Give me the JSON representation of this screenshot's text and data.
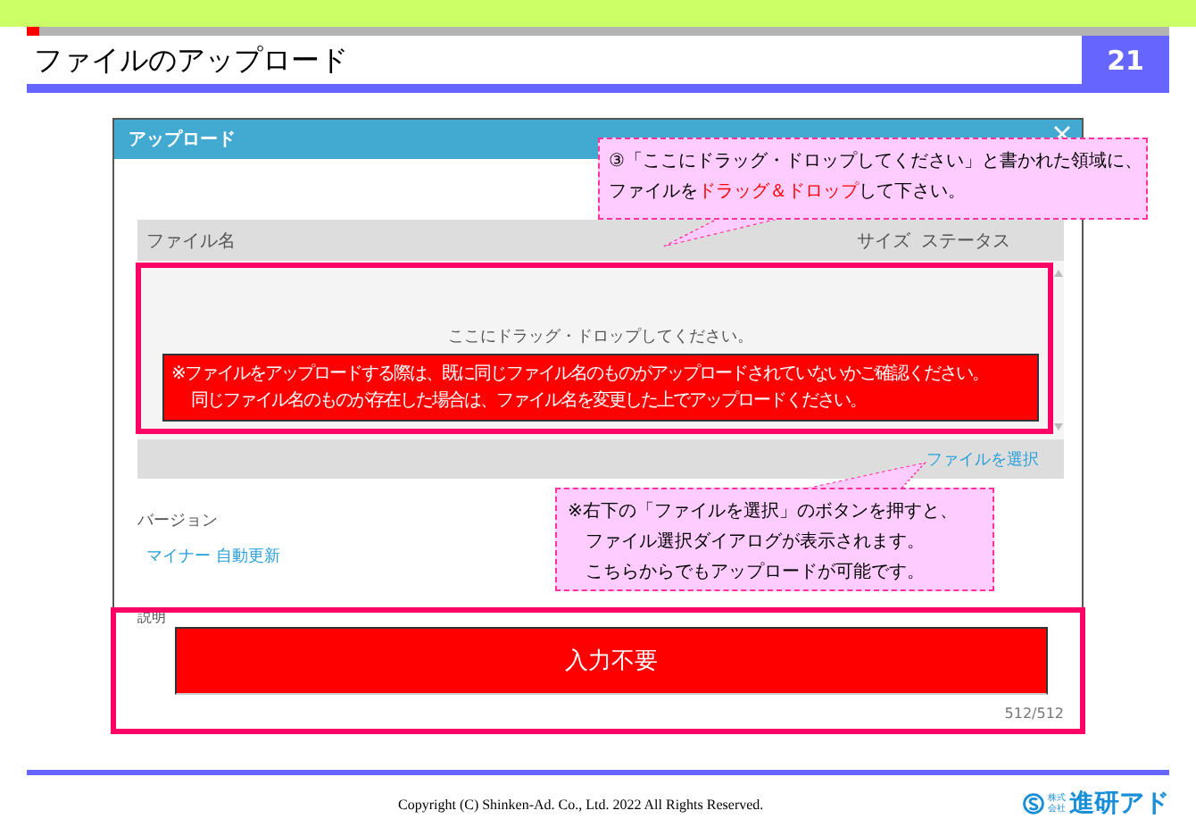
{
  "slide": {
    "title": "ファイルのアップロード",
    "page_number": "21"
  },
  "dialog": {
    "title": "アップロード",
    "table_header": {
      "name": "ファイル名",
      "size": "サイズ",
      "status": "ステータス"
    },
    "drop_hint": "ここにドラッグ・ドロップしてください。",
    "warning_lines": [
      "※ファイルをアップロードする際は、既に同じファイル名のものがアップロードされていないかご確認ください。",
      "同じファイル名のものが存在した場合は、ファイル名を変更した上でアップロードください。"
    ],
    "select_button": "ファイルを選択",
    "version_label": "バージョン",
    "version_value": "マイナー 自動更新",
    "description_label": "説明",
    "description_value": "入力不要",
    "counter": "512/512"
  },
  "callouts": [
    {
      "lines": [
        [
          {
            "text": "③「ここにドラッグ・ドロップしてください」と書かれた領域に、",
            "emphasis": false
          }
        ],
        [
          {
            "text": "ファイルを",
            "emphasis": false
          },
          {
            "text": "ドラッグ＆ドロップ",
            "emphasis": true
          },
          {
            "text": "して下さい。",
            "emphasis": false
          }
        ]
      ]
    },
    {
      "lines": [
        [
          {
            "text": "※右下の「ファイルを選択」のボタンを押すと、",
            "emphasis": false
          }
        ],
        [
          {
            "text": "　ファイル選択ダイアログが表示されます。",
            "emphasis": false
          }
        ],
        [
          {
            "text": "　こちらからでもアップロードが可能です。",
            "emphasis": false
          }
        ]
      ]
    }
  ],
  "footer": {
    "copyright": "Copyright (C) Shinken-Ad. Co., Ltd. 2022 All Rights Reserved.",
    "logo_small": [
      "株式",
      "会社"
    ],
    "logo_name": "進研アド"
  }
}
